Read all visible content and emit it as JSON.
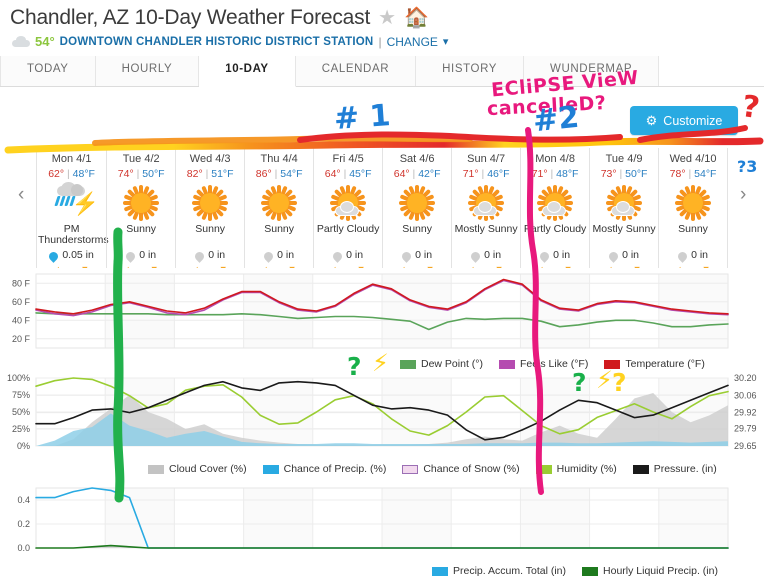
{
  "header": {
    "title": "Chandler, AZ 10-Day Weather Forecast",
    "star_icon": "star-icon",
    "home_icon": "home-icon",
    "current_temp": "54°",
    "station": "DOWNTOWN CHANDLER HISTORIC DISTRICT STATION",
    "separator": "|",
    "change_label": "CHANGE",
    "chevron": "⌄"
  },
  "tabs": [
    {
      "label": "TODAY",
      "active": false
    },
    {
      "label": "HOURLY",
      "active": false
    },
    {
      "label": "10-DAY",
      "active": true
    },
    {
      "label": "CALENDAR",
      "active": false
    },
    {
      "label": "HISTORY",
      "active": false
    },
    {
      "label": "WUNDERMAP",
      "active": false
    }
  ],
  "customize": {
    "label": "Customize",
    "icon": "gear-icon",
    "color": "#29aae2"
  },
  "nav": {
    "prev": "‹",
    "next": "›"
  },
  "forecast": [
    {
      "day": "Mon 4/1",
      "hi": "62°",
      "lo": "48°F",
      "icon": "thunderstorm-icon",
      "cond": "PM Thunderstorms",
      "precip": "0.05 in",
      "precip_active": true
    },
    {
      "day": "Tue 4/2",
      "hi": "74°",
      "lo": "50°F",
      "icon": "sunny-icon",
      "cond": "Sunny",
      "precip": "0 in",
      "precip_active": false
    },
    {
      "day": "Wed 4/3",
      "hi": "82°",
      "lo": "51°F",
      "icon": "sunny-icon",
      "cond": "Sunny",
      "precip": "0 in",
      "precip_active": false
    },
    {
      "day": "Thu 4/4",
      "hi": "86°",
      "lo": "54°F",
      "icon": "sunny-icon",
      "cond": "Sunny",
      "precip": "0 in",
      "precip_active": false
    },
    {
      "day": "Fri 4/5",
      "hi": "64°",
      "lo": "45°F",
      "icon": "partly-cloudy-icon",
      "cond": "Partly Cloudy",
      "precip": "0 in",
      "precip_active": false
    },
    {
      "day": "Sat 4/6",
      "hi": "64°",
      "lo": "42°F",
      "icon": "sunny-icon",
      "cond": "Sunny",
      "precip": "0 in",
      "precip_active": false
    },
    {
      "day": "Sun 4/7",
      "hi": "71°",
      "lo": "46°F",
      "icon": "partly-cloudy-icon",
      "cond": "Mostly Sunny",
      "precip": "0 in",
      "precip_active": false
    },
    {
      "day": "Mon 4/8",
      "hi": "71°",
      "lo": "48°F",
      "icon": "partly-cloudy-icon",
      "cond": "Partly Cloudy",
      "precip": "0 in",
      "precip_active": false
    },
    {
      "day": "Tue 4/9",
      "hi": "73°",
      "lo": "50°F",
      "icon": "partly-cloudy-icon",
      "cond": "Mostly Sunny",
      "precip": "0 in",
      "precip_active": false
    },
    {
      "day": "Wed 4/10",
      "hi": "78°",
      "lo": "54°F",
      "icon": "sunny-icon",
      "cond": "Sunny",
      "precip": "0 in",
      "precip_active": false
    }
  ],
  "sun_markers": {
    "sunrise_glyph": "▲",
    "sunset_glyph": "▼",
    "color": "#f5a623"
  },
  "annotations": [
    {
      "name": "eclipse-note",
      "text_line1": "ECliPSE VieW",
      "text_line2": "cancelleD?",
      "color": "#e8197d"
    },
    {
      "name": "marker-hash-1",
      "text": "# 1",
      "color": "#1f7fd6"
    },
    {
      "name": "marker-hash-2",
      "text": "#2",
      "color": "#1f7fd6"
    },
    {
      "name": "question-red",
      "text": "?",
      "color": "#e4292b"
    },
    {
      "name": "question-3",
      "text": "?3",
      "color": "#1f7fd6"
    },
    {
      "name": "question-green-1",
      "text": "?",
      "color": "#19b04a"
    },
    {
      "name": "bolt-1",
      "text": "⚡",
      "color": "#ffd21f"
    },
    {
      "name": "question-green-2",
      "text": "?",
      "color": "#19b04a"
    },
    {
      "name": "bolt-2",
      "text": "⚡",
      "color": "#ffd21f"
    },
    {
      "name": "question-yellow",
      "text": "?",
      "color": "#ffd21f"
    },
    {
      "name": "highlight-stroke-horizontal",
      "colors": [
        "#ffd21f",
        "#f6941d",
        "#e4292b"
      ]
    },
    {
      "name": "highlight-stroke-green-vertical",
      "color": "#22b14c"
    },
    {
      "name": "highlight-stroke-pink-vertical",
      "color": "#e8197d"
    }
  ],
  "chart_data": [
    {
      "name": "temperature-chart",
      "type": "line",
      "title": "",
      "xlabel": "",
      "ylabel": "",
      "ylim": [
        10,
        90
      ],
      "yticks": [
        "20 F",
        "40 F",
        "60 F",
        "80 F"
      ],
      "ytick_values": [
        20,
        40,
        60,
        80
      ],
      "grid": true,
      "legend_position": "bottom",
      "categories": [
        "Mon 4/1",
        "Tue 4/2",
        "Wed 4/3",
        "Thu 4/4",
        "Fri 4/5",
        "Sat 4/6",
        "Sun 4/7",
        "Mon 4/8",
        "Tue 4/9",
        "Wed 4/10"
      ],
      "series": [
        {
          "name": "Temperature (°F)",
          "color": "#d0191e",
          "values": [
            52,
            49,
            47,
            51,
            57,
            60,
            55,
            50,
            48,
            53,
            63,
            71,
            71,
            60,
            52,
            50,
            56,
            69,
            79,
            74,
            62,
            55,
            52,
            60,
            74,
            84,
            79,
            62,
            53,
            51,
            58,
            61,
            60,
            56,
            52,
            50,
            48,
            47
          ]
        },
        {
          "name": "Feels Like (°F)",
          "color": "#b54bb0",
          "values": [
            51,
            47,
            45,
            49,
            56,
            59,
            54,
            48,
            46,
            51,
            62,
            70,
            70,
            59,
            51,
            49,
            55,
            68,
            78,
            73,
            61,
            54,
            51,
            59,
            73,
            83,
            78,
            61,
            52,
            50,
            57,
            60,
            59,
            55,
            51,
            49,
            47,
            46
          ]
        },
        {
          "name": "Dew Point (°)",
          "color": "#5aa45a",
          "values": [
            48,
            47,
            47,
            47,
            47,
            47,
            47,
            46,
            46,
            46,
            46,
            47,
            46,
            44,
            42,
            43,
            44,
            44,
            43,
            41,
            39,
            30,
            38,
            42,
            41,
            42,
            42,
            39,
            33,
            35,
            38,
            40,
            40,
            37,
            33,
            33,
            35,
            36
          ]
        }
      ]
    },
    {
      "name": "humidity-pressure-chart",
      "type": "area-line",
      "ylim": [
        0,
        100
      ],
      "yticks": [
        "0%",
        "25%",
        "50%",
        "75%",
        "100%"
      ],
      "ytick_values": [
        0,
        25,
        50,
        75,
        100
      ],
      "y2ticks": [
        "29.65",
        "29.79",
        "29.92",
        "30.06",
        "30.20"
      ],
      "y2lim": [
        29.65,
        30.2
      ],
      "grid": true,
      "legend_position": "bottom",
      "series": [
        {
          "name": "Cloud Cover (%)",
          "color": "#c3c3c3",
          "type": "area",
          "values": [
            0,
            0,
            10,
            35,
            55,
            75,
            50,
            40,
            25,
            32,
            18,
            12,
            8,
            5,
            3,
            2,
            2,
            2,
            2,
            2,
            2,
            3,
            5,
            10,
            14,
            10,
            8,
            20,
            30,
            18,
            12,
            40,
            70,
            78,
            50,
            35,
            45,
            60
          ]
        },
        {
          "name": "Chance of Precip. (%)",
          "color": "#29aae2",
          "type": "area",
          "values": [
            0,
            8,
            22,
            28,
            48,
            30,
            22,
            12,
            18,
            22,
            14,
            6,
            4,
            3,
            3,
            3,
            4,
            4,
            3,
            3,
            3,
            3,
            3,
            3,
            4,
            4,
            4,
            5,
            5,
            4,
            4,
            5,
            6,
            7,
            6,
            5,
            6,
            7
          ]
        },
        {
          "name": "Chance of Snow (%)",
          "color": "#f2d9ee",
          "type": "area",
          "values": [
            0,
            0,
            0,
            0,
            0,
            0,
            0,
            0,
            0,
            0,
            0,
            0,
            0,
            0,
            0,
            0,
            0,
            0,
            0,
            0,
            0,
            0,
            0,
            0,
            0,
            0,
            0,
            0,
            0,
            0,
            0,
            0,
            0,
            0,
            0,
            0,
            0,
            0
          ]
        },
        {
          "name": "Humidity (%)",
          "color": "#9acd32",
          "type": "line",
          "values": [
            88,
            96,
            100,
            98,
            88,
            74,
            56,
            62,
            82,
            88,
            90,
            72,
            45,
            32,
            34,
            50,
            68,
            74,
            62,
            40,
            22,
            16,
            30,
            50,
            72,
            74,
            52,
            30,
            18,
            24,
            42,
            52,
            62,
            50,
            40,
            58,
            74,
            80
          ]
        },
        {
          "name": "Pressure. (in)",
          "color": "#1a1a1a",
          "type": "line",
          "values": [
            29.83,
            29.83,
            29.88,
            29.94,
            29.95,
            29.92,
            29.96,
            30.02,
            30.08,
            30.14,
            30.17,
            30.12,
            30.1,
            30.16,
            30.17,
            30.16,
            30.14,
            30.06,
            29.98,
            29.95,
            29.96,
            29.94,
            29.9,
            29.78,
            29.7,
            29.72,
            29.78,
            29.85,
            29.94,
            30.02,
            30.0,
            29.94,
            29.88,
            29.9,
            29.96,
            30.02,
            30.08,
            30.14
          ]
        }
      ]
    },
    {
      "name": "precipitation-chart",
      "type": "line",
      "ylim": [
        0.0,
        0.5
      ],
      "yticks": [
        "0.0",
        "0.2",
        "0.4"
      ],
      "ytick_values": [
        0.0,
        0.2,
        0.4
      ],
      "grid": true,
      "legend_position": "bottom",
      "series": [
        {
          "name": "Precip. Accum. Total (in)",
          "color": "#29aae2",
          "values": [
            0.42,
            0.42,
            0.47,
            0.5,
            0.48,
            0.42,
            0,
            0,
            0,
            0,
            0,
            0,
            0,
            0,
            0,
            0,
            0,
            0,
            0,
            0,
            0,
            0,
            0,
            0,
            0,
            0,
            0,
            0,
            0,
            0,
            0,
            0,
            0,
            0,
            0,
            0,
            0,
            0
          ]
        },
        {
          "name": "Hourly Liquid Precip. (in)",
          "color": "#1e7a1e",
          "values": [
            0,
            0,
            0,
            0.01,
            0.02,
            0.01,
            0,
            0,
            0,
            0,
            0,
            0,
            0,
            0,
            0,
            0,
            0,
            0,
            0,
            0,
            0,
            0,
            0,
            0,
            0,
            0,
            0,
            0,
            0,
            0,
            0,
            0,
            0,
            0,
            0,
            0,
            0,
            0
          ]
        }
      ]
    }
  ]
}
